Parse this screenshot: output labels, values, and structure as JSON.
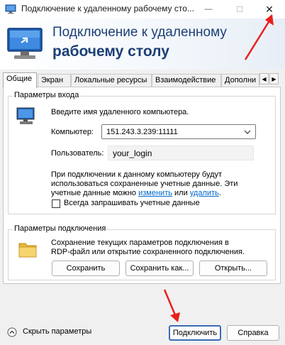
{
  "window": {
    "title": "Подключение к удаленному рабочему сто...",
    "minimize": "—",
    "maximize": "☐",
    "close": "✕"
  },
  "banner": {
    "line1": "Подключение к удаленному",
    "line2": "рабочему столу"
  },
  "tabs": [
    {
      "label": "Общие",
      "active": true
    },
    {
      "label": "Экран"
    },
    {
      "label": "Локальные ресурсы"
    },
    {
      "label": "Взаимодействие"
    },
    {
      "label": "Дополни"
    }
  ],
  "tab_scroll": {
    "left": "◀",
    "right": "▶"
  },
  "login": {
    "group_title": "Параметры входа",
    "prompt": "Введите имя удаленного компьютера.",
    "computer_label": "Компьютер:",
    "computer_value": "151.243.3.239:11111",
    "user_label": "Пользователь:",
    "user_value": "your_login",
    "info_part1": "При подключении к данному компьютеру будут",
    "info_part2": "использоваться сохраненные учетные данные.  Эти",
    "info_part3_prefix": "учетные данные можно ",
    "info_link_change": "изменить",
    "info_part3_mid": " или ",
    "info_link_delete": "удалить",
    "info_part3_suffix": ".",
    "always_ask": "Всегда запрашивать учетные данные",
    "always_ask_checked": false
  },
  "connection": {
    "group_title": "Параметры подключения",
    "desc_line1": "Сохранение текущих параметров подключения в",
    "desc_line2": "RDP-файл или открытие сохраненного подключения.",
    "save": "Сохранить",
    "save_as": "Сохранить как...",
    "open": "Открыть..."
  },
  "footer": {
    "hide_params": "Скрыть параметры",
    "connect": "Подключить",
    "help": "Справка"
  },
  "colors": {
    "banner_text": "#1c3f75",
    "link": "#0066cc",
    "annotation_arrow": "#e8201c",
    "default_button_border": "#3b6cb6"
  }
}
